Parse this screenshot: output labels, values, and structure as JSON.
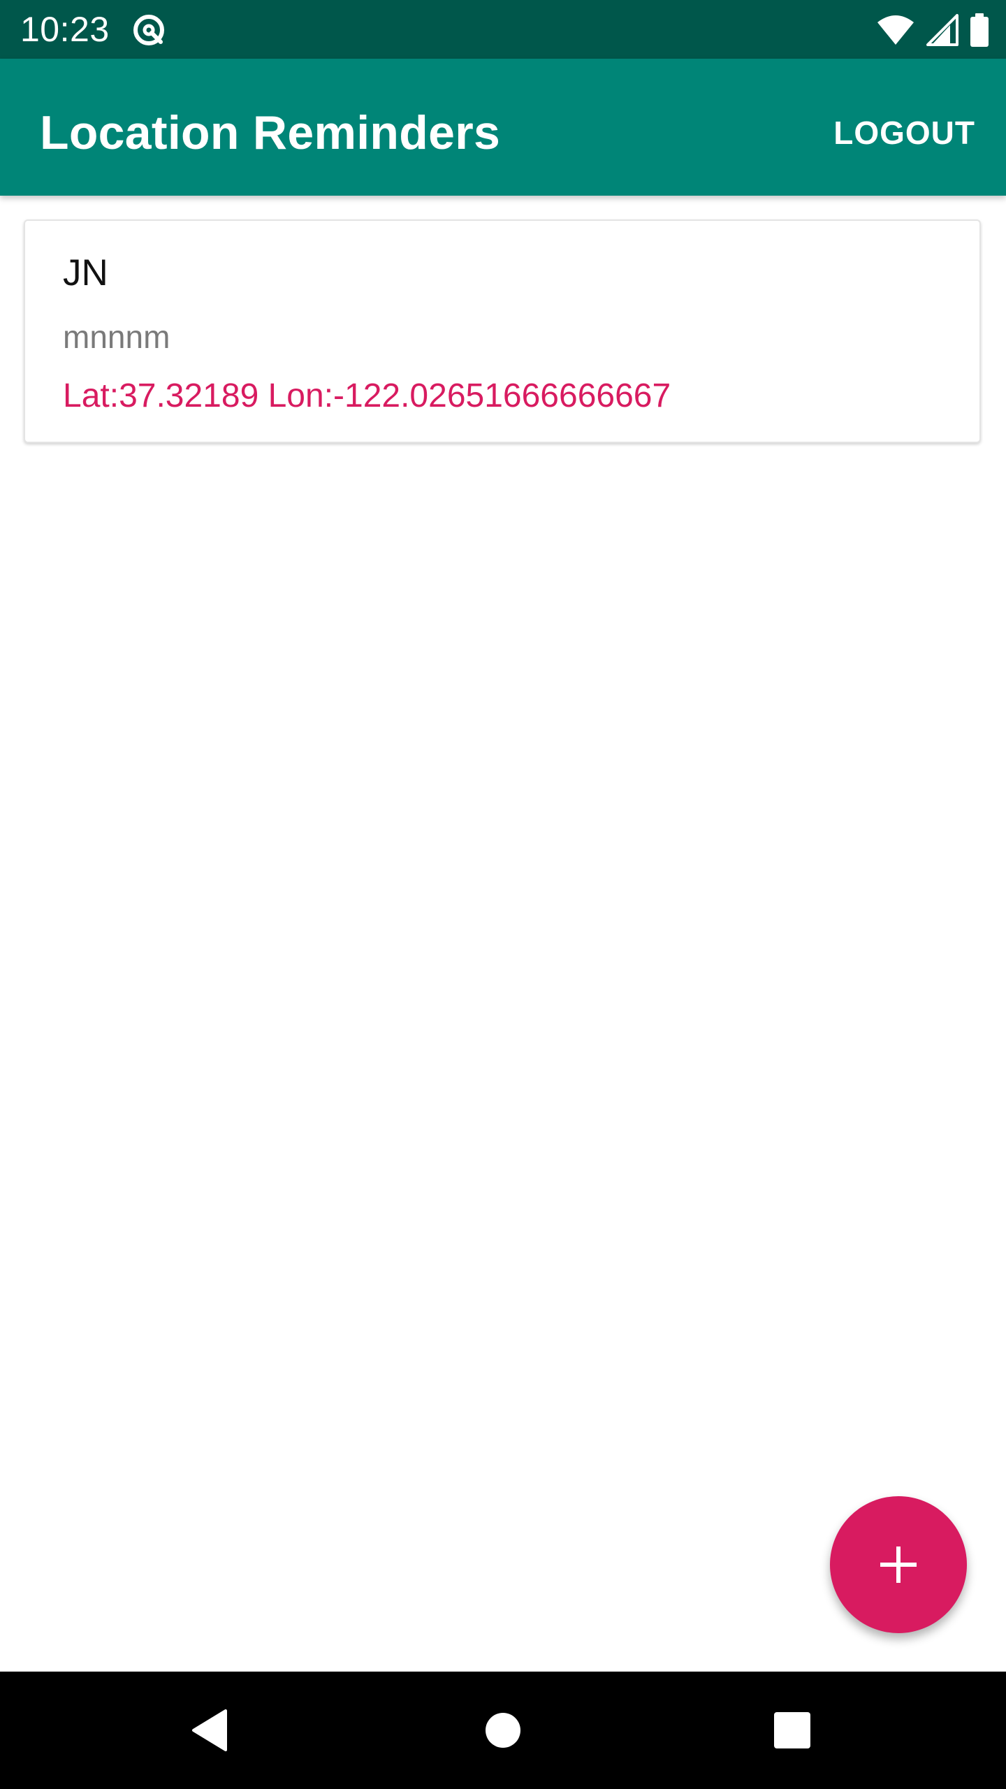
{
  "status_bar": {
    "time": "10:23",
    "icons": [
      "notification-icon",
      "wifi-icon",
      "cellular-icon",
      "battery-icon"
    ]
  },
  "app_bar": {
    "title": "Location Reminders",
    "logout_label": "LOGOUT"
  },
  "reminders": [
    {
      "title": "JN",
      "description": "mnnnm",
      "location": "Lat:37.32189 Lon:-122.02651666666667"
    }
  ],
  "fab": {
    "icon": "add-icon"
  },
  "nav_bar": {
    "icons": [
      "back-icon",
      "home-icon",
      "recents-icon"
    ]
  },
  "colors": {
    "status_bar": "#00574b",
    "app_bar": "#008577",
    "accent": "#d81b60",
    "nav_bar": "#000000"
  }
}
